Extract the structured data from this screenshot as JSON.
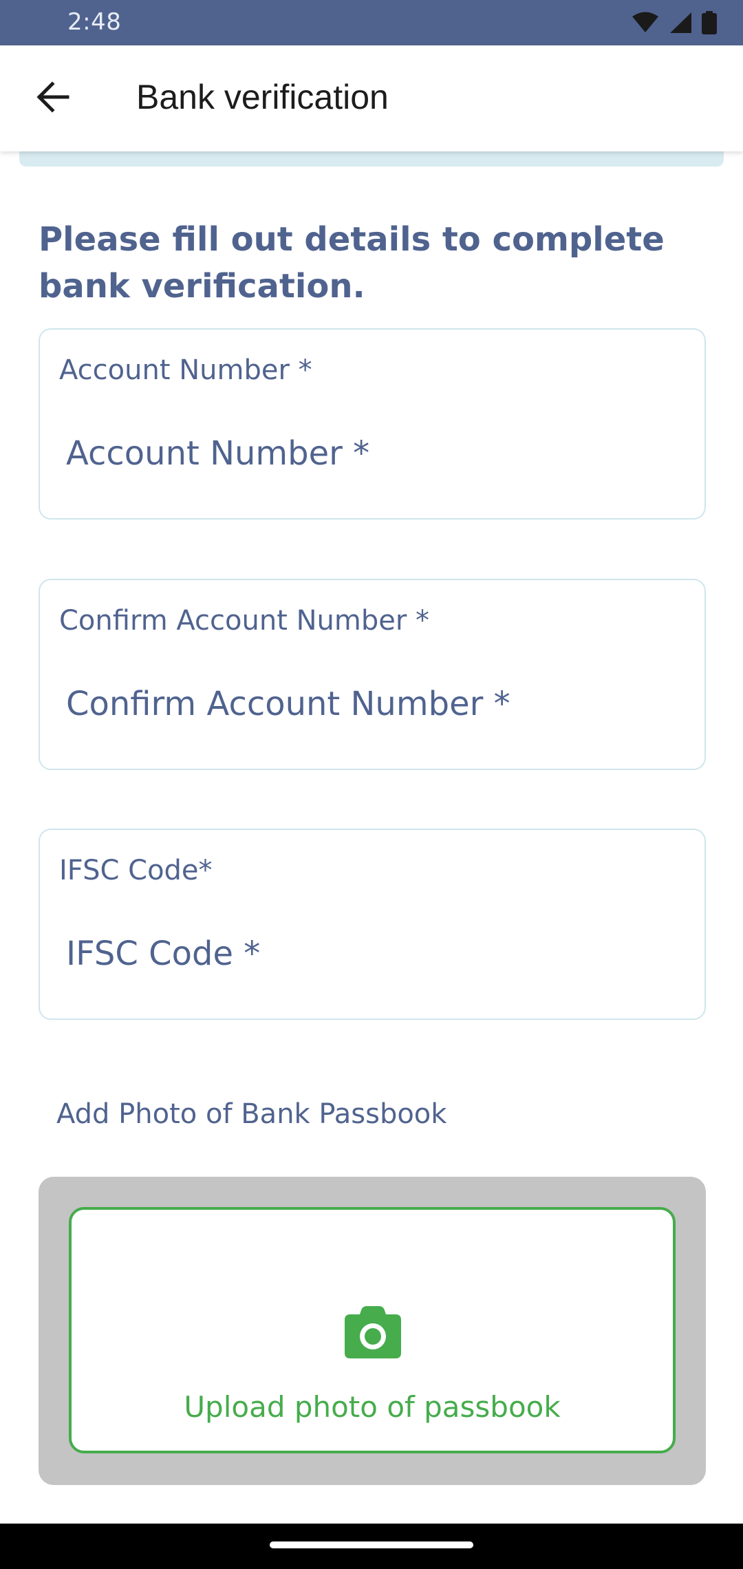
{
  "status_bar": {
    "time": "2:48",
    "icons": [
      "wifi-icon",
      "cellular-signal-icon",
      "battery-icon"
    ]
  },
  "app_bar": {
    "back_icon": "arrow-left-icon",
    "title": "Bank verification"
  },
  "intro_text": "Please fill out details to complete bank verification.",
  "fields": [
    {
      "label": "Account Number *",
      "placeholder": "Account Number *",
      "value": ""
    },
    {
      "label": "Confirm Account Number *",
      "placeholder": "Confirm Account Number *",
      "value": ""
    },
    {
      "label": "IFSC Code*",
      "placeholder": "IFSC Code *",
      "value": ""
    }
  ],
  "passbook": {
    "section_label": "Add Photo of Bank Passbook",
    "upload_icon": "camera-icon",
    "upload_text": "Upload photo of passbook"
  },
  "colors": {
    "primary": "#50638f",
    "accent_green": "#46ac4c",
    "field_border": "#cfe6ec",
    "upload_backdrop": "#c4c4c4",
    "banner": "#d8ebf0"
  }
}
